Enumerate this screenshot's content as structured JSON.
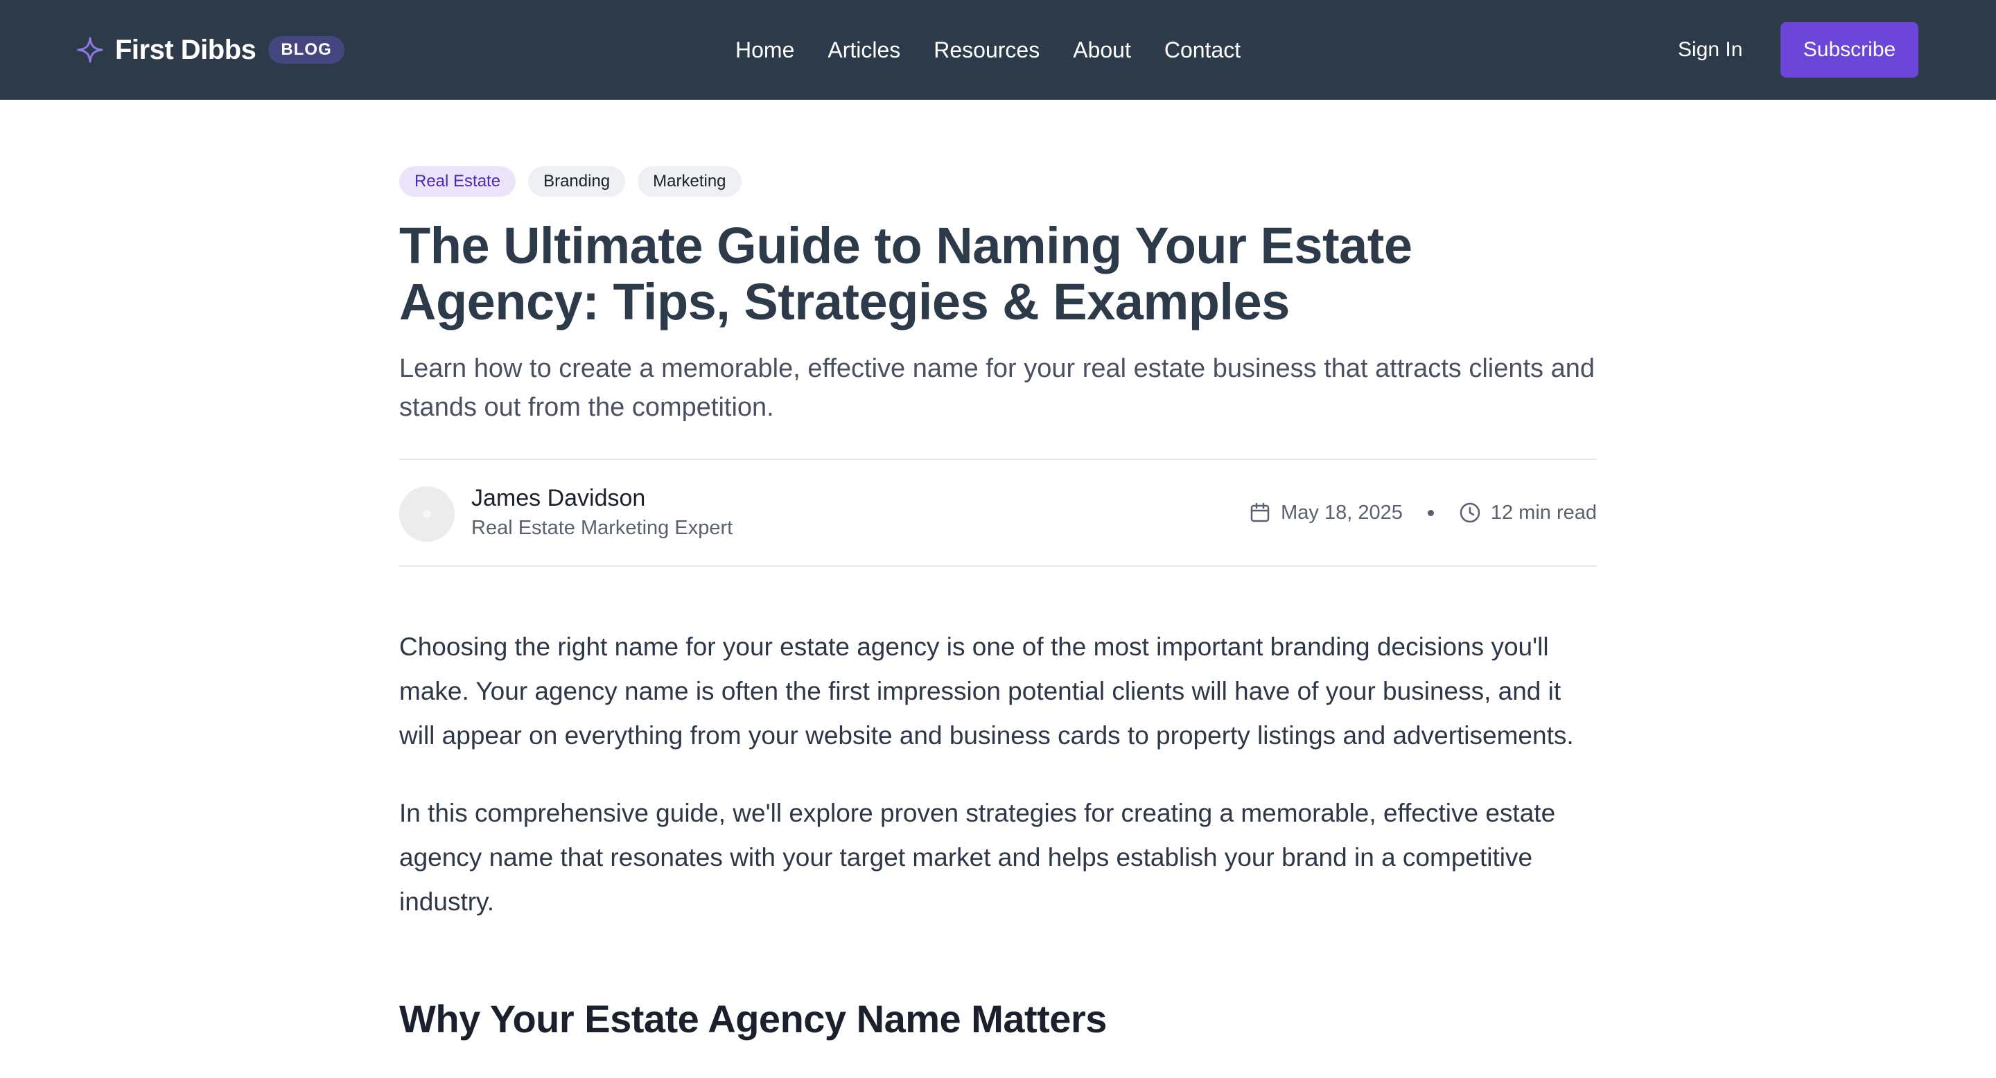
{
  "header": {
    "brand_name": "First Dibbs",
    "brand_badge": "BLOG",
    "nav": [
      "Home",
      "Articles",
      "Resources",
      "About",
      "Contact"
    ],
    "sign_in": "Sign In",
    "subscribe": "Subscribe"
  },
  "article": {
    "tags": [
      "Real Estate",
      "Branding",
      "Marketing"
    ],
    "title": "The Ultimate Guide to Naming Your Estate Agency: Tips, Strategies & Examples",
    "subtitle": "Learn how to create a memorable, effective name for your real estate business that attracts clients and stands out from the competition.",
    "author": {
      "name": "James Davidson",
      "role": "Real Estate Marketing Expert"
    },
    "date": "May 18, 2025",
    "read_time": "12 min read",
    "paragraphs": [
      "Choosing the right name for your estate agency is one of the most important branding decisions you'll make. Your agency name is often the first impression potential clients will have of your business, and it will appear on everything from your website and business cards to property listings and advertisements.",
      "In this comprehensive guide, we'll explore proven strategies for creating a memorable, effective estate agency name that resonates with your target market and helps establish your brand in a competitive industry."
    ],
    "section_heading": "Why Your Estate Agency Name Matters"
  },
  "colors": {
    "header_bg": "#2d3a4a",
    "accent": "#6b46d8",
    "title": "#2d3a4a"
  },
  "icons": [
    "sparkle-icon",
    "calendar-icon",
    "clock-icon"
  ]
}
